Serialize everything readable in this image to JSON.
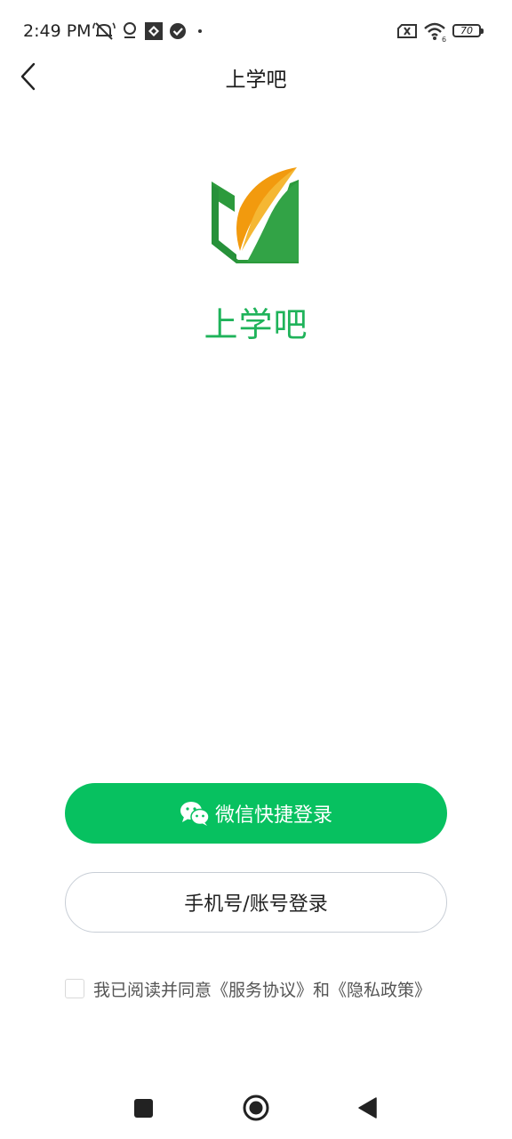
{
  "status_bar": {
    "time": "2:49 PM",
    "battery": "70",
    "icons": [
      "mute-icon",
      "location-icon",
      "app-icon",
      "check-icon",
      "sim-off-icon",
      "wifi-icon",
      "battery-icon"
    ]
  },
  "nav": {
    "title": "上学吧",
    "back_icon": "chevron-left-icon"
  },
  "logo": {
    "app_name": "上学吧",
    "brand_color": "#1fb35a",
    "accent_color": "#f29a0e"
  },
  "buttons": {
    "wechat_login": "微信快捷登录",
    "phone_login": "手机号/账号登录",
    "wechat_color": "#07c160"
  },
  "agreement": {
    "checked": false,
    "text": "我已阅读并同意《服务协议》和《隐私政策》"
  },
  "system_nav": {
    "recent": "square-icon",
    "home": "circle-home-icon",
    "back": "triangle-back-icon"
  }
}
